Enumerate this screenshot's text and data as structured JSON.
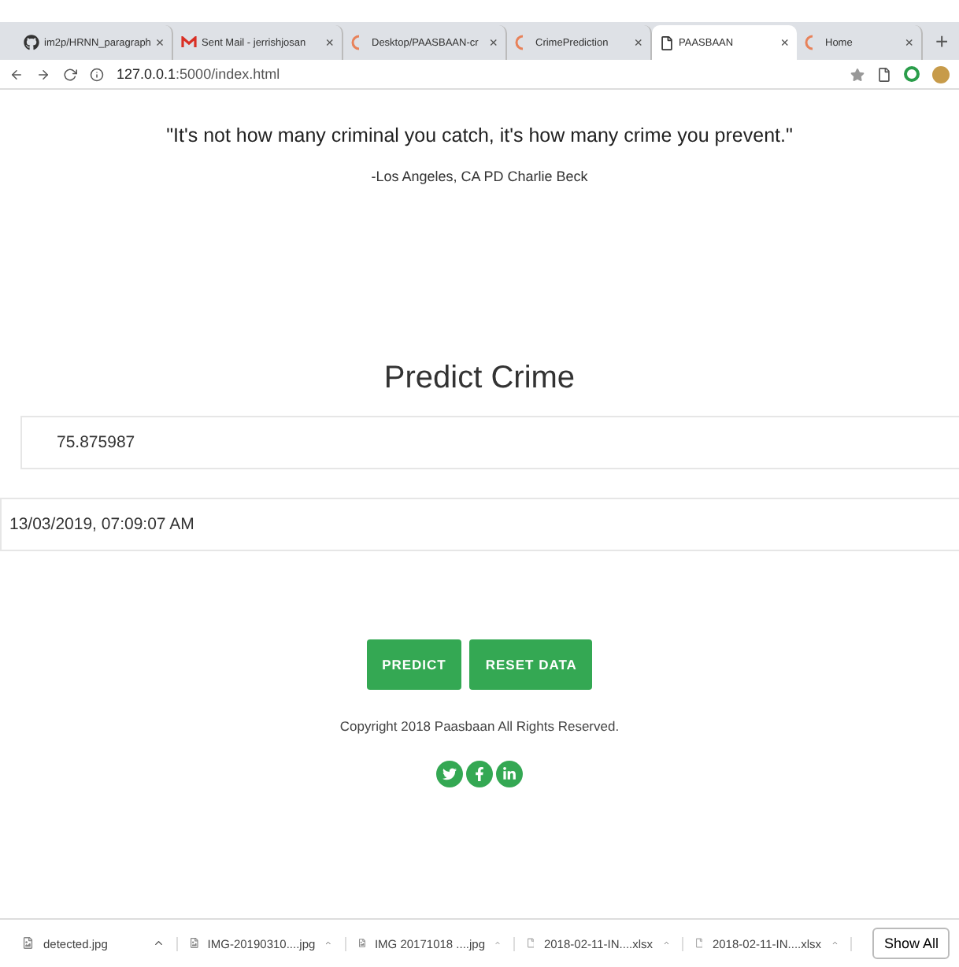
{
  "browser": {
    "tabs": [
      {
        "label": "im2p/HRNN_paragraph",
        "kind": "github",
        "close": "×",
        "selected": false
      },
      {
        "label": "Sent Mail - jerrishjosan",
        "kind": "mail",
        "close": "×",
        "selected": false
      },
      {
        "label": "Desktop/PAASBAAN-cr",
        "kind": "loading",
        "close": "×",
        "selected": false
      },
      {
        "label": "CrimePrediction",
        "kind": "loading",
        "close": "×",
        "selected": false
      },
      {
        "label": "PAASBAAN",
        "kind": "page",
        "close": "×",
        "selected": true
      },
      {
        "label": "Home",
        "kind": "loading",
        "close": "×",
        "selected": false
      }
    ],
    "new_tab": "+",
    "address": {
      "host": "127.0.0.1",
      "rest": ":5000/index.html"
    }
  },
  "quote": "\"It's not how many criminal you catch, it's how many crime you prevent.\"",
  "author": "-Los Angeles, CA PD Charlie Beck",
  "heading": "Predict Crime",
  "fields": [
    {
      "value": "75.875987"
    },
    {
      "value": "13/03/2019, 07:09:07 AM"
    }
  ],
  "buttons": [
    "PREDICT",
    "RESET DATA"
  ],
  "copyright": "Copyright 2018 Paasbaan All Rights Reserved.",
  "social": [
    {
      "kind": "twitter"
    },
    {
      "kind": "facebook"
    },
    {
      "kind": "linkedin"
    }
  ],
  "downloads": [
    {
      "name": "detected.jpg",
      "kind": "image"
    },
    {
      "name": "IMG-20190310....jpg",
      "kind": "image"
    },
    {
      "name": "IMG 20171018 ....jpg",
      "kind": "image"
    },
    {
      "name": "2018-02-11-IN....xlsx",
      "kind": "file"
    },
    {
      "name": "2018-02-11-IN....xlsx",
      "kind": "file"
    }
  ],
  "show_all": "Show All"
}
